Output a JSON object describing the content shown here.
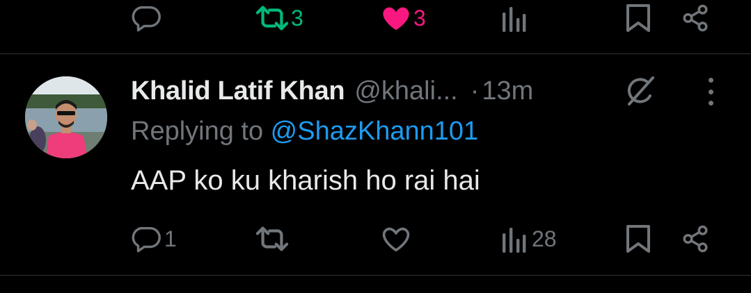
{
  "colors": {
    "background": "#000000",
    "text_primary": "#e7e9ea",
    "text_secondary": "#71767b",
    "link": "#1d9bf0",
    "retweet_active": "#00ba7c",
    "like_active": "#f91880",
    "divider": "#2f3336"
  },
  "prev_tweet_actions": {
    "reply": {
      "icon": "reply-icon",
      "count": ""
    },
    "retweet": {
      "icon": "retweet-icon",
      "count": "3",
      "active": true
    },
    "like": {
      "icon": "heart-filled-icon",
      "count": "3",
      "active": true
    },
    "views": {
      "icon": "views-icon",
      "count": ""
    },
    "bookmark": {
      "icon": "bookmark-icon"
    },
    "share": {
      "icon": "share-icon"
    }
  },
  "tweet": {
    "author_name": "Khalid Latif Khan",
    "handle": "@khali...",
    "separator": "·",
    "time": "13m",
    "reply_prefix": "Replying to ",
    "reply_to": "@ShazKhann101",
    "text": "AAP ko ku kharish ho rai hai",
    "actions": {
      "reply": {
        "icon": "reply-icon",
        "count": "1"
      },
      "retweet": {
        "icon": "retweet-icon",
        "count": ""
      },
      "like": {
        "icon": "heart-icon",
        "count": ""
      },
      "views": {
        "icon": "views-icon",
        "count": "28"
      },
      "bookmark": {
        "icon": "bookmark-icon"
      },
      "share": {
        "icon": "share-icon"
      }
    }
  }
}
